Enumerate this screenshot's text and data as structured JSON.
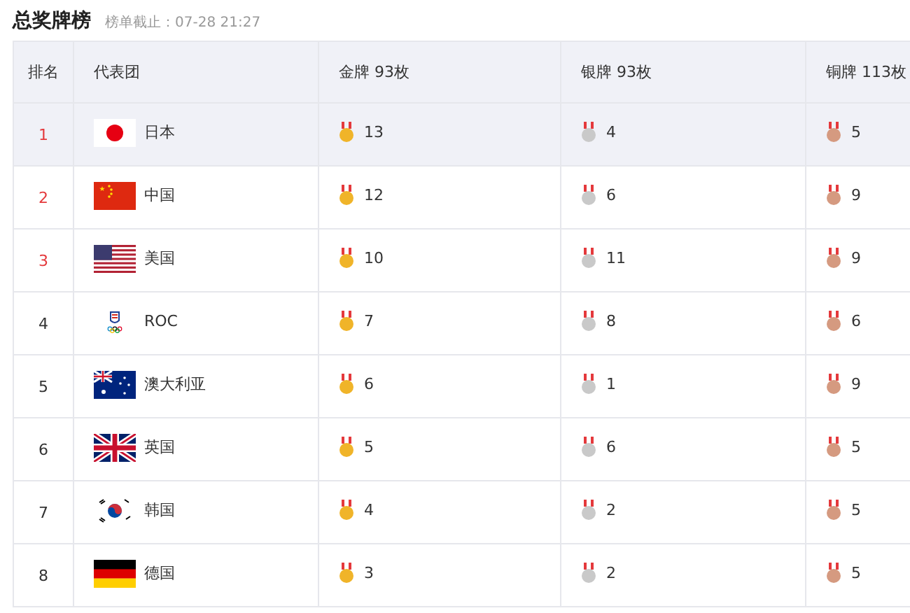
{
  "title": "总奖牌榜",
  "update_time": "榜单截止：07-28 21:27",
  "columns": [
    "排名",
    "代表团",
    "金牌 93枚",
    "银牌 93枚",
    "铜牌 113枚"
  ],
  "rows": [
    {
      "rank": "1",
      "top3": true,
      "selected": true,
      "kind": "jp",
      "team": "日本",
      "gold": "13",
      "silver": "4",
      "bronze": "5"
    },
    {
      "rank": "2",
      "top3": true,
      "selected": false,
      "kind": "cn",
      "team": "中国",
      "gold": "12",
      "silver": "6",
      "bronze": "9"
    },
    {
      "rank": "3",
      "top3": true,
      "selected": false,
      "kind": "us",
      "team": "美国",
      "gold": "10",
      "silver": "11",
      "bronze": "9"
    },
    {
      "rank": "4",
      "top3": false,
      "selected": false,
      "kind": "roc",
      "team": "ROC",
      "gold": "7",
      "silver": "8",
      "bronze": "6"
    },
    {
      "rank": "5",
      "top3": false,
      "selected": false,
      "kind": "au",
      "team": "澳大利亚",
      "gold": "6",
      "silver": "1",
      "bronze": "9"
    },
    {
      "rank": "6",
      "top3": false,
      "selected": false,
      "kind": "gb",
      "team": "英国",
      "gold": "5",
      "silver": "6",
      "bronze": "5"
    },
    {
      "rank": "7",
      "top3": false,
      "selected": false,
      "kind": "kr",
      "team": "韩国",
      "gold": "4",
      "silver": "2",
      "bronze": "5"
    },
    {
      "rank": "8",
      "top3": false,
      "selected": false,
      "kind": "de",
      "team": "德国",
      "gold": "3",
      "silver": "2",
      "bronze": "5"
    }
  ]
}
